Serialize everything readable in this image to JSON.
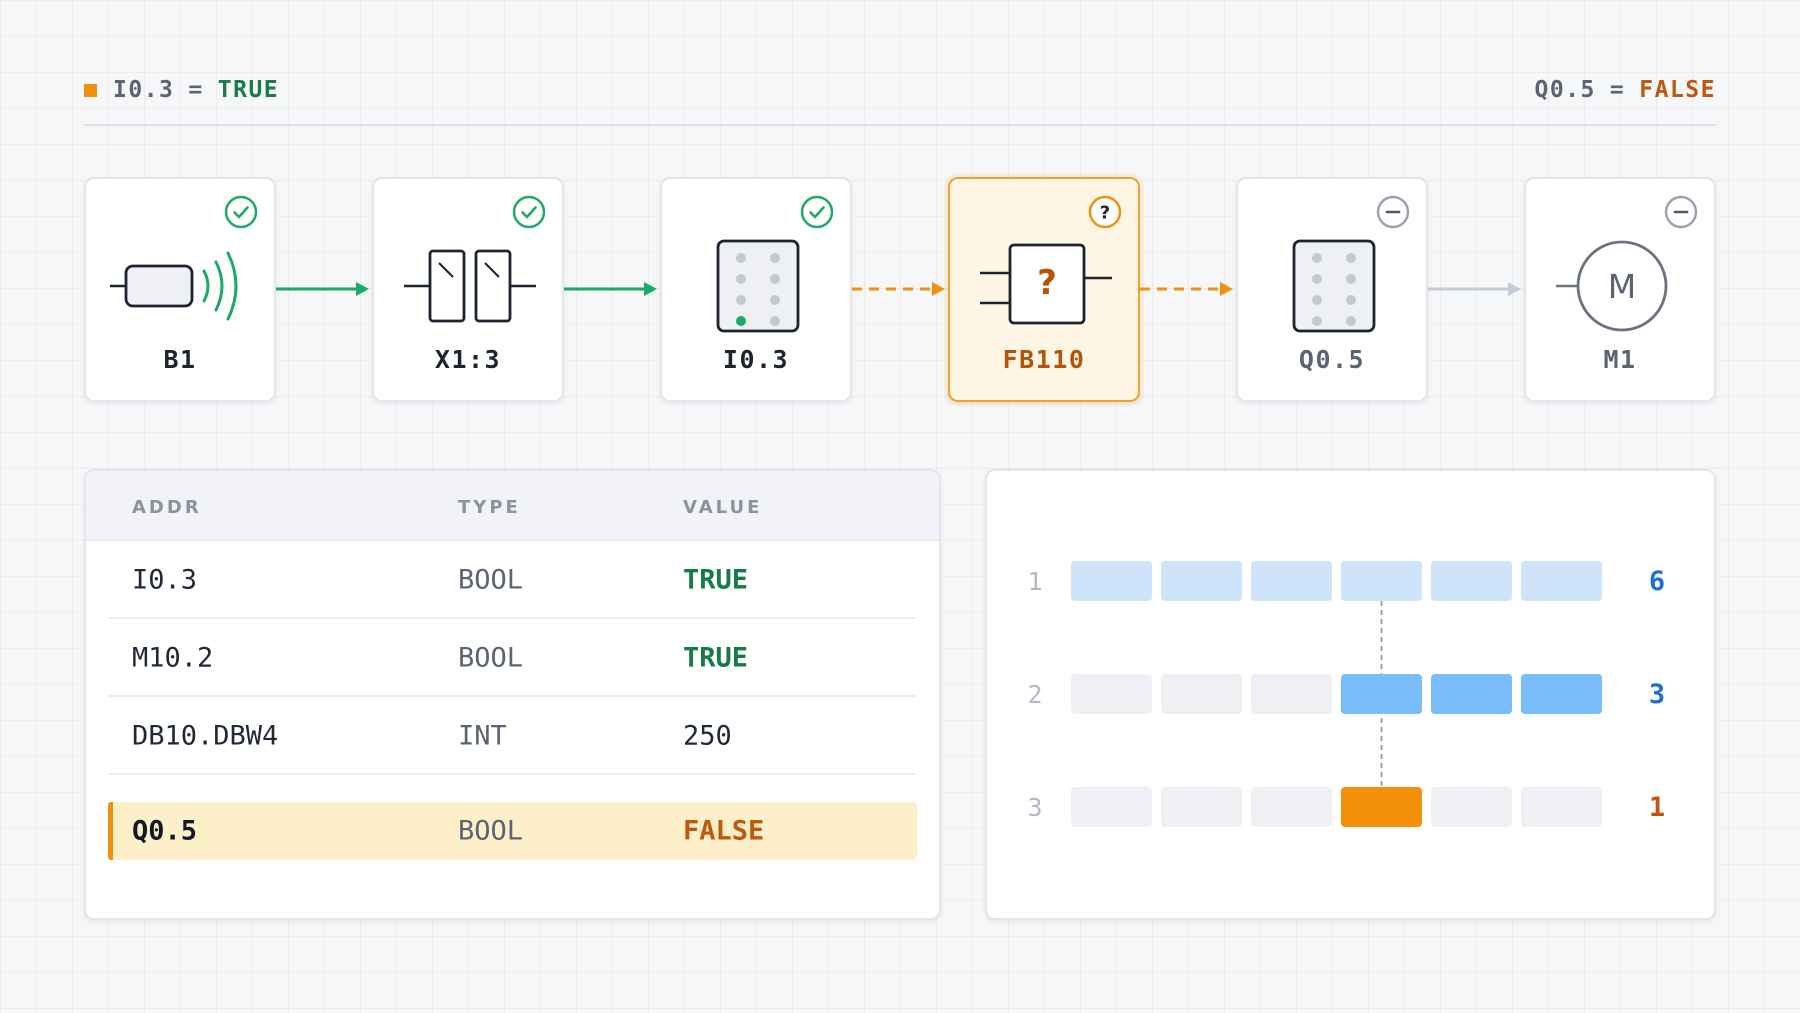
{
  "header": {
    "left": {
      "address": "I0.3",
      "operator": "=",
      "value": "TRUE",
      "marker_color": "#f0900f"
    },
    "right": {
      "address": "Q0.5",
      "operator": "=",
      "value": "FALSE"
    }
  },
  "chain": [
    {
      "label": "B1",
      "icon": "proximity-sensor-icon",
      "status": "ok"
    },
    {
      "label": "X1:3",
      "icon": "terminal-block-icon",
      "status": "ok"
    },
    {
      "label": "I0.3",
      "icon": "input-module-icon",
      "status": "ok"
    },
    {
      "label": "FB110",
      "icon": "function-block-icon",
      "status": "unknown",
      "symbol_text": "?"
    },
    {
      "label": "Q0.5",
      "icon": "output-module-icon",
      "status": "inactive"
    },
    {
      "label": "M1",
      "icon": "motor-icon",
      "status": "inactive",
      "symbol_text": "M"
    }
  ],
  "links": [
    {
      "style": "solid",
      "color": "#1ea86a"
    },
    {
      "style": "solid",
      "color": "#1ea86a"
    },
    {
      "style": "dashed",
      "color": "#f0900f"
    },
    {
      "style": "dashed",
      "color": "#f0900f"
    },
    {
      "style": "solid",
      "color": "#c5ccd6"
    }
  ],
  "table": {
    "columns": [
      "ADDR",
      "TYPE",
      "VALUE"
    ],
    "rows": [
      {
        "addr": "I0.3",
        "type": "BOOL",
        "value": "TRUE",
        "state": "true"
      },
      {
        "addr": "M10.2",
        "type": "BOOL",
        "value": "TRUE",
        "state": "true"
      },
      {
        "addr": "DB10.DBW4",
        "type": "INT",
        "value": "250",
        "state": "plain"
      },
      {
        "addr": "Q0.5",
        "type": "BOOL",
        "value": "FALSE",
        "state": "false"
      }
    ]
  },
  "scan": {
    "slots_per_row": 6,
    "marker_slot": 4,
    "rows": [
      {
        "label": "1",
        "count": "6",
        "active_from": 1,
        "active_to": 6,
        "fill": "#cfe3fb",
        "count_color": "#1d6fd1"
      },
      {
        "label": "2",
        "count": "3",
        "active_from": 4,
        "active_to": 6,
        "fill": "#79bdfa",
        "count_color": "#1d6fd1"
      },
      {
        "label": "3",
        "count": "1",
        "active_from": 4,
        "active_to": 4,
        "fill": "#f5900c",
        "count_color": "#c0570e"
      }
    ],
    "inactive_fill": "#eef0f3",
    "row_label_color": "#b3bac4"
  },
  "colors": {
    "ok": "#1ea86a",
    "unknown": "#f0900f",
    "inactive": "#9aa3ae",
    "ink": "#1c2430"
  }
}
